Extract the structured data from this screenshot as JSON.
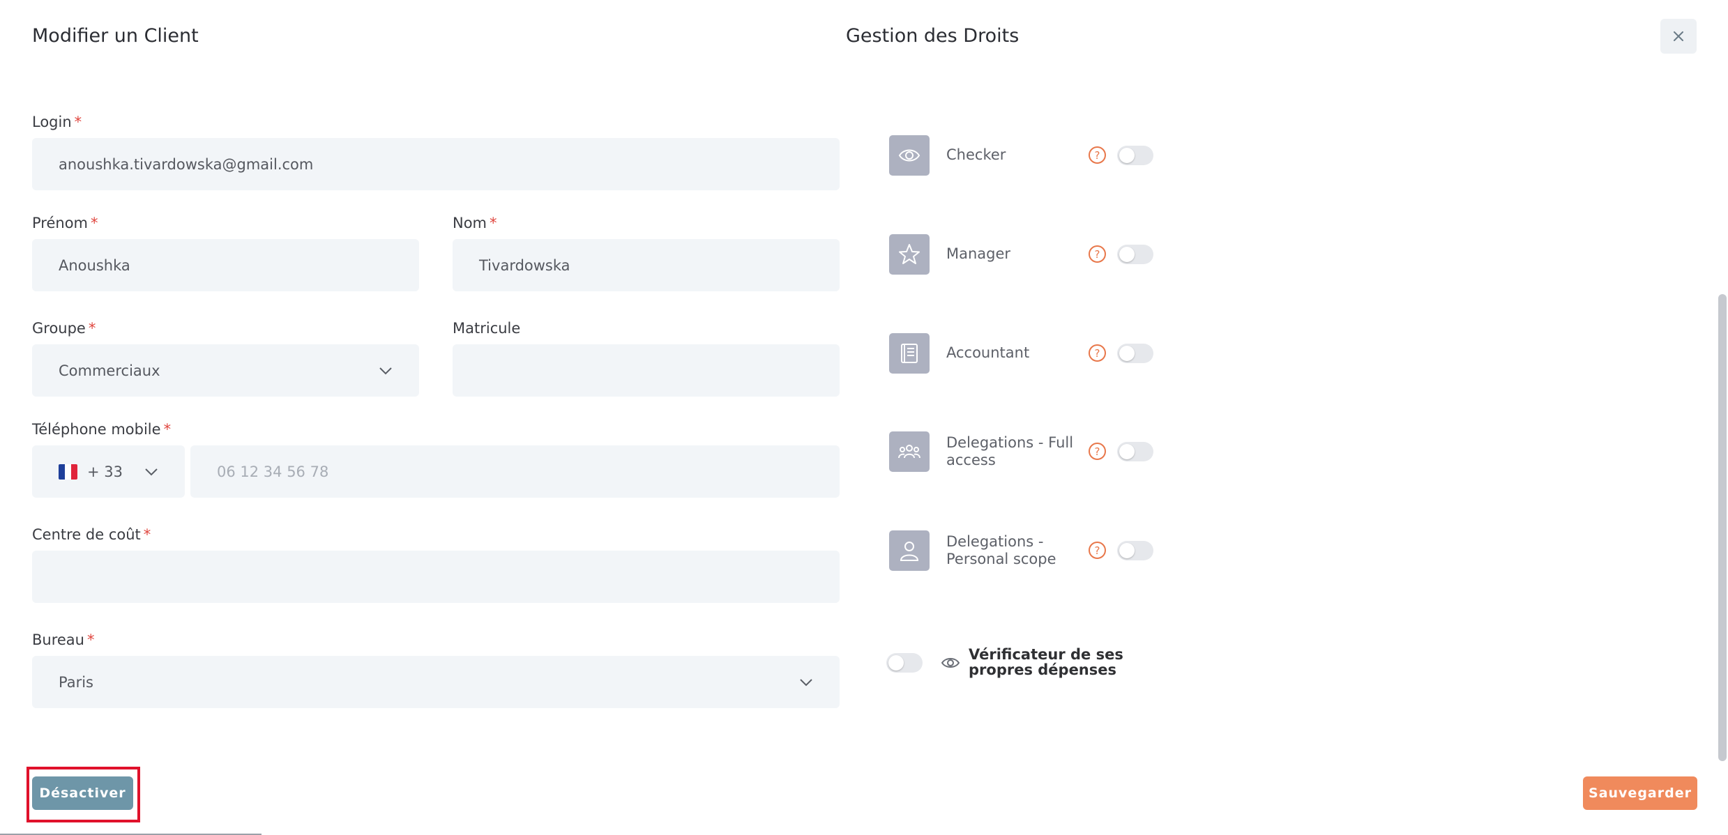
{
  "left_panel": {
    "title": "Modifier un Client",
    "login": {
      "label": "Login",
      "required": "*",
      "value": "anoushka.tivardowska@gmail.com"
    },
    "prenom": {
      "label": "Prénom",
      "required": "*",
      "value": "Anoushka"
    },
    "nom": {
      "label": "Nom",
      "required": "*",
      "value": "Tivardowska"
    },
    "groupe": {
      "label": "Groupe",
      "required": "*",
      "value": "Commerciaux"
    },
    "matricule": {
      "label": "Matricule",
      "value": ""
    },
    "telephone": {
      "label": "Téléphone mobile",
      "required": "*",
      "country_code": "+ 33",
      "placeholder": "06 12 34 56 78"
    },
    "centre_cout": {
      "label": "Centre de coût",
      "required": "*",
      "value": ""
    },
    "bureau": {
      "label": "Bureau",
      "required": "*",
      "value": "Paris"
    }
  },
  "right_panel": {
    "title": "Gestion des Droits",
    "permissions": [
      {
        "label": "Checker",
        "icon": "eye-icon",
        "enabled": false
      },
      {
        "label": "Manager",
        "icon": "star-icon",
        "enabled": false
      },
      {
        "label": "Accountant",
        "icon": "book-icon",
        "enabled": false
      },
      {
        "label": "Delegations - Full access",
        "icon": "users-icon",
        "enabled": false
      },
      {
        "label": "Delegations - Personal scope",
        "icon": "user-icon",
        "enabled": false
      }
    ],
    "self_verifier": {
      "label": "Vérificateur de ses propres dépenses",
      "enabled": false
    }
  },
  "footer": {
    "deactivate_label": "Désactiver",
    "save_label": "Sauvegarder"
  },
  "colors": {
    "deactivate": "#6e96a8",
    "save": "#f08a5c",
    "required": "#e0463f",
    "help": "#e8774a",
    "highlight": "#e0112b"
  }
}
